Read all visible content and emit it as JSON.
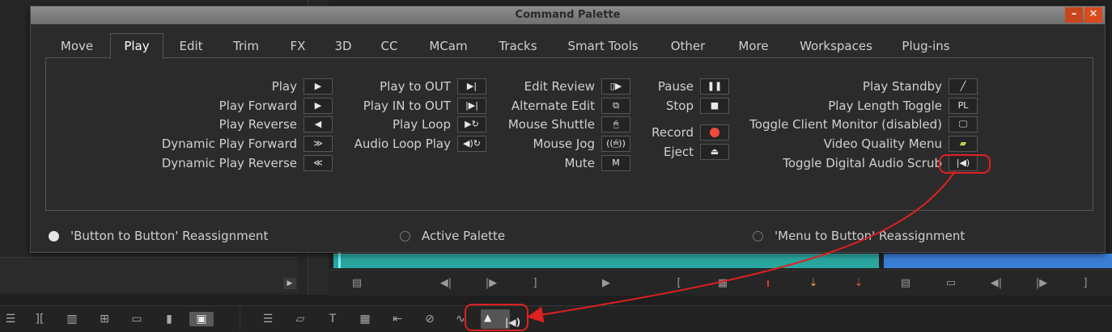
{
  "dialog": {
    "title": "Command Palette",
    "minimize_glyph": "–",
    "close_glyph": "✕"
  },
  "tabs": [
    "Move",
    "Play",
    "Edit",
    "Trim",
    "FX",
    "3D",
    "CC",
    "MCam",
    "Tracks",
    "Smart Tools",
    "Other",
    "More",
    "Workspaces",
    "Plug-ins"
  ],
  "active_tab": "Play",
  "commands": {
    "col1": [
      {
        "label": "Play",
        "icon": "play-icon",
        "glyph": "▶"
      },
      {
        "label": "Play Forward",
        "icon": "play-forward-icon",
        "glyph": "▶"
      },
      {
        "label": "Play Reverse",
        "icon": "play-reverse-icon",
        "glyph": "◀"
      },
      {
        "label": "Dynamic Play Forward",
        "icon": "dynamic-play-forward-icon",
        "glyph": "≫"
      },
      {
        "label": "Dynamic Play Reverse",
        "icon": "dynamic-play-reverse-icon",
        "glyph": "≪"
      }
    ],
    "col2": [
      {
        "label": "Play to OUT",
        "icon": "play-to-out-icon",
        "glyph": "▶|"
      },
      {
        "label": "Play IN to OUT",
        "icon": "play-in-to-out-icon",
        "glyph": "|▶|"
      },
      {
        "label": "Play Loop",
        "icon": "play-loop-icon",
        "glyph": "▶↻"
      },
      {
        "label": "Audio Loop Play",
        "icon": "audio-loop-play-icon",
        "glyph": "◀)↻"
      }
    ],
    "col3": [
      {
        "label": "Edit Review",
        "icon": "edit-review-icon",
        "glyph": "▯▶"
      },
      {
        "label": "Alternate Edit",
        "icon": "alternate-edit-icon",
        "glyph": "⧉"
      },
      {
        "label": "Mouse Shuttle",
        "icon": "mouse-shuttle-icon",
        "glyph": "🖱"
      },
      {
        "label": "Mouse Jog",
        "icon": "mouse-jog-icon",
        "glyph": "((🖱))"
      },
      {
        "label": "Mute",
        "icon": "mute-icon",
        "glyph": "M"
      }
    ],
    "col4": [
      {
        "label": "Pause",
        "icon": "pause-icon",
        "glyph": "❚❚"
      },
      {
        "label": "Stop",
        "icon": "stop-icon",
        "glyph": "■"
      },
      {
        "label": "Record",
        "icon": "record-icon",
        "glyph": ""
      },
      {
        "label": "Eject",
        "icon": "eject-icon",
        "glyph": "⏏"
      }
    ],
    "col5": [
      {
        "label": "Play Standby",
        "icon": "play-standby-icon",
        "glyph": "╱"
      },
      {
        "label": "Play Length Toggle",
        "icon": "play-length-toggle-icon",
        "glyph": "PL"
      },
      {
        "label": "Toggle Client Monitor (disabled)",
        "icon": "client-monitor-icon",
        "glyph": "🖵"
      },
      {
        "label": "Video Quality Menu",
        "icon": "video-quality-icon",
        "glyph": "▰"
      },
      {
        "label": "Toggle Digital Audio Scrub",
        "icon": "digital-audio-scrub-icon",
        "glyph": "|◀)"
      }
    ]
  },
  "modes": {
    "button_to_button": "'Button to Button' Reassignment",
    "active_palette": "Active Palette",
    "menu_to_button": "'Menu to Button' Reassignment"
  },
  "colors": {
    "highlight": "#e02020",
    "timeline_green": "#2aa6a0",
    "timeline_blue": "#3b7ed6",
    "record_red": "#f04a3a"
  }
}
